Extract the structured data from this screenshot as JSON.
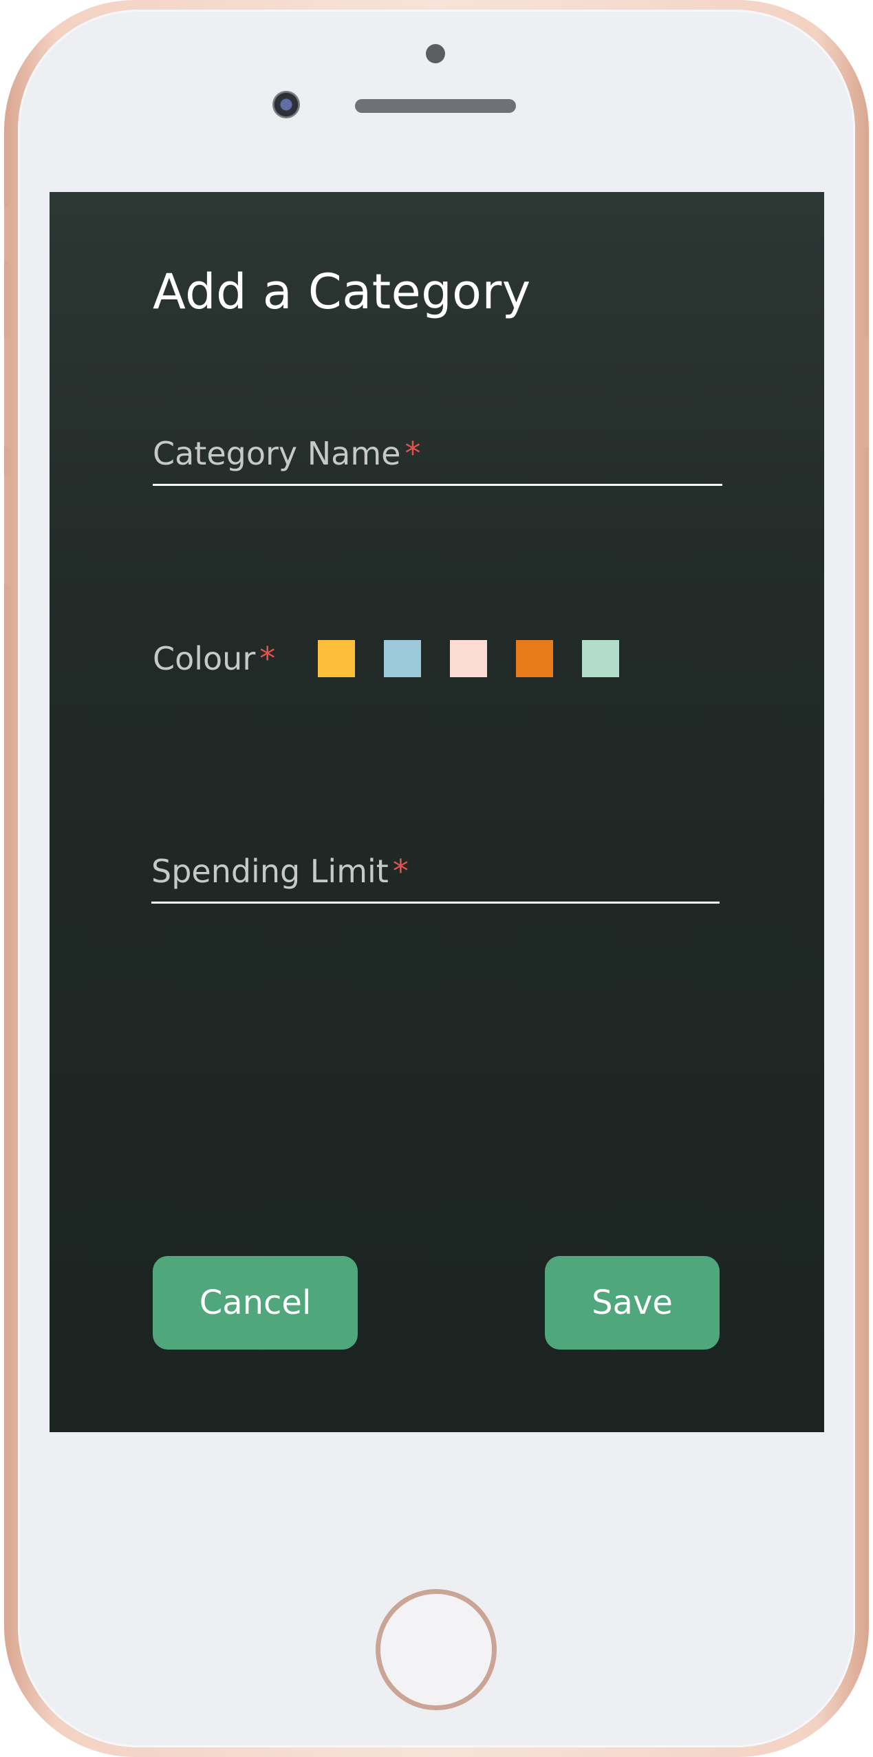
{
  "page": {
    "title": "Add a Category"
  },
  "form": {
    "category_name": {
      "label": "Category Name",
      "required_mark": "*",
      "value": ""
    },
    "colour": {
      "label": "Colour",
      "required_mark": "*",
      "options": [
        "#FDBF3A",
        "#9CC9D9",
        "#FDDBD5",
        "#E77B1B",
        "#B2DDCB"
      ]
    },
    "spending_limit": {
      "label": "Spending Limit",
      "required_mark": "*",
      "value": ""
    }
  },
  "actions": {
    "cancel_label": "Cancel",
    "save_label": "Save"
  },
  "nav": {
    "items": [
      {
        "icon": "home-icon",
        "active": false
      },
      {
        "icon": "calendar-icon",
        "active": false
      },
      {
        "icon": "add-circle-icon",
        "active": false
      },
      {
        "icon": "profile-card-icon",
        "active": true
      }
    ]
  },
  "colors": {
    "accent": "#4FA77B",
    "background": "#1F2926",
    "required": "#E0524C",
    "nav_icon_inactive": "#9B9B9B"
  }
}
